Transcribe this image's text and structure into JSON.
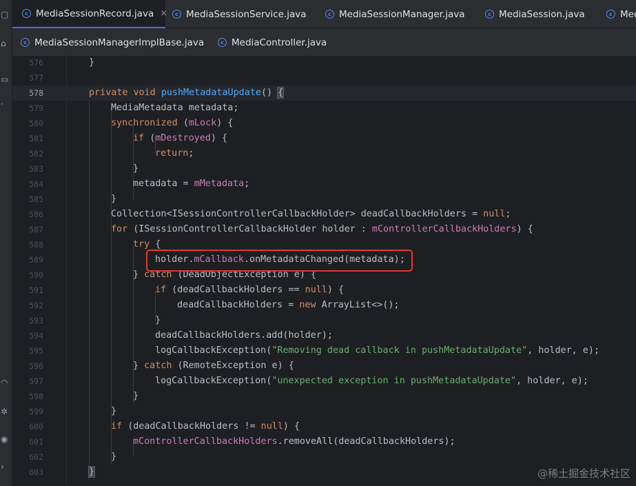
{
  "tabs_row1": [
    {
      "label": "MediaSessionRecord.java",
      "active": true,
      "closable": true
    },
    {
      "label": "MediaSessionService.java"
    },
    {
      "label": "MediaSessionManager.java"
    },
    {
      "label": "MediaSession.java"
    },
    {
      "label": "Med"
    }
  ],
  "tabs_row2": [
    {
      "label": "MediaSessionManagerImplBase.java"
    },
    {
      "label": "MediaController.java"
    }
  ],
  "file_icon_glyph": "c",
  "close_glyph": "×",
  "lines": [
    {
      "n": "576",
      "tokens": [
        [
          "}",
          ""
        ]
      ]
    },
    {
      "n": "577",
      "tokens": []
    },
    {
      "n": "578",
      "tokens": [
        [
          "private void ",
          "kw"
        ],
        [
          "pushMetadataUpdate",
          "fn"
        ],
        [
          "() ",
          ""
        ],
        [
          "{",
          "brace"
        ]
      ]
    },
    {
      "n": "579",
      "tokens": [
        [
          "MediaMetadata metadata;",
          ""
        ]
      ]
    },
    {
      "n": "580",
      "tokens": [
        [
          "synchronized ",
          "kw"
        ],
        [
          "(",
          ""
        ],
        [
          "mLock",
          "fld"
        ],
        [
          ") {",
          ""
        ]
      ]
    },
    {
      "n": "581",
      "tokens": [
        [
          "if ",
          "kw"
        ],
        [
          "(",
          ""
        ],
        [
          "mDestroyed",
          "fld"
        ],
        [
          ") {",
          ""
        ]
      ]
    },
    {
      "n": "582",
      "tokens": [
        [
          "return",
          "kw"
        ],
        [
          ";",
          ""
        ]
      ]
    },
    {
      "n": "583",
      "tokens": [
        [
          "}",
          ""
        ]
      ]
    },
    {
      "n": "584",
      "tokens": [
        [
          "metadata = ",
          ""
        ],
        [
          "mMetadata",
          "fld"
        ],
        [
          ";",
          ""
        ]
      ]
    },
    {
      "n": "585",
      "tokens": [
        [
          "}",
          ""
        ]
      ]
    },
    {
      "n": "586",
      "tokens": [
        [
          "Collection<ISessionControllerCallbackHolder> deadCallbackHolders = ",
          ""
        ],
        [
          "null",
          "kw"
        ],
        [
          ";",
          ""
        ]
      ]
    },
    {
      "n": "587",
      "tokens": [
        [
          "for ",
          "kw"
        ],
        [
          "(ISessionControllerCallbackHolder holder : ",
          ""
        ],
        [
          "mControllerCallbackHolders",
          "fld"
        ],
        [
          ") {",
          ""
        ]
      ]
    },
    {
      "n": "588",
      "tokens": [
        [
          "try ",
          "kw"
        ],
        [
          "{",
          ""
        ]
      ]
    },
    {
      "n": "589",
      "tokens": [
        [
          "holder.",
          ""
        ],
        [
          "mCallback",
          "fld"
        ],
        [
          ".onMetadataChanged(metadata);",
          ""
        ]
      ]
    },
    {
      "n": "590",
      "tokens": [
        [
          "} ",
          ""
        ],
        [
          "catch ",
          "kw"
        ],
        [
          "(DeadObjectException e) {",
          ""
        ]
      ]
    },
    {
      "n": "591",
      "tokens": [
        [
          "if ",
          "kw"
        ],
        [
          "(deadCallbackHolders == ",
          ""
        ],
        [
          "null",
          "kw"
        ],
        [
          ") {",
          ""
        ]
      ]
    },
    {
      "n": "592",
      "tokens": [
        [
          "deadCallbackHolders = ",
          ""
        ],
        [
          "new ",
          "kw"
        ],
        [
          "ArrayList<>();",
          ""
        ]
      ]
    },
    {
      "n": "593",
      "tokens": [
        [
          "}",
          ""
        ]
      ]
    },
    {
      "n": "594",
      "tokens": [
        [
          "deadCallbackHolders.add(holder);",
          ""
        ]
      ]
    },
    {
      "n": "595",
      "tokens": [
        [
          "logCallbackException(",
          ""
        ],
        [
          "\"Removing dead callback in pushMetadataUpdate\"",
          "str"
        ],
        [
          ", holder, e);",
          ""
        ]
      ]
    },
    {
      "n": "596",
      "tokens": [
        [
          "} ",
          ""
        ],
        [
          "catch ",
          "kw"
        ],
        [
          "(RemoteException e) {",
          ""
        ]
      ]
    },
    {
      "n": "597",
      "tokens": [
        [
          "logCallbackException(",
          ""
        ],
        [
          "\"unexpected exception in pushMetadataUpdate\"",
          "str"
        ],
        [
          ", holder, e);",
          ""
        ]
      ]
    },
    {
      "n": "598",
      "tokens": [
        [
          "}",
          ""
        ]
      ]
    },
    {
      "n": "599",
      "tokens": [
        [
          "}",
          ""
        ]
      ]
    },
    {
      "n": "600",
      "tokens": [
        [
          "if ",
          "kw"
        ],
        [
          "(deadCallbackHolders != ",
          ""
        ],
        [
          "null",
          "kw"
        ],
        [
          ") {",
          ""
        ]
      ]
    },
    {
      "n": "601",
      "tokens": [
        [
          "mControllerCallbackHolders",
          "fld"
        ],
        [
          ".removeAll(deadCallbackHolders);",
          ""
        ]
      ]
    },
    {
      "n": "602",
      "tokens": [
        [
          "}",
          ""
        ]
      ]
    },
    {
      "n": "603",
      "tokens": [
        [
          "}",
          "brace"
        ]
      ]
    }
  ],
  "current_line": "578",
  "watermark": "@稀土掘金技术社区",
  "colors": {
    "background": "#1e1f22",
    "keyword": "#cf8e6d",
    "function": "#56a8f5",
    "field": "#c77dbb",
    "string": "#6aab73",
    "highlight_box": "#e03a2f"
  }
}
